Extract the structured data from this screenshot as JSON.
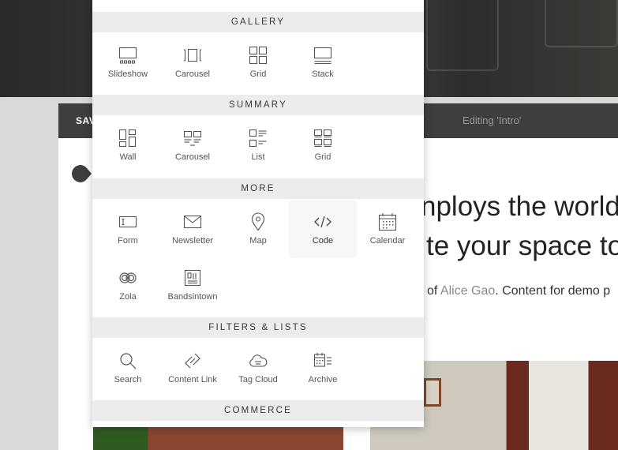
{
  "editor": {
    "save_label": "SAV",
    "editing_label": "Editing 'Intro'"
  },
  "page": {
    "headline_line1": "nploys the world",
    "headline_line2": "te your space to",
    "subline_prefix": "of ",
    "subline_link": "Alice Gao",
    "subline_suffix": ". Content for demo p"
  },
  "menu": {
    "sections": {
      "gallery": "GALLERY",
      "summary": "SUMMARY",
      "more": "MORE",
      "filters": "FILTERS & LISTS",
      "commerce": "COMMERCE"
    },
    "gallery": [
      {
        "label": "Slideshow",
        "icon": "slideshow-icon"
      },
      {
        "label": "Carousel",
        "icon": "carousel-icon"
      },
      {
        "label": "Grid",
        "icon": "grid-icon"
      },
      {
        "label": "Stack",
        "icon": "stack-icon"
      }
    ],
    "summary": [
      {
        "label": "Wall",
        "icon": "wall-icon"
      },
      {
        "label": "Carousel",
        "icon": "carousel-icon"
      },
      {
        "label": "List",
        "icon": "list-icon"
      },
      {
        "label": "Grid",
        "icon": "grid-icon"
      }
    ],
    "more": [
      {
        "label": "Form",
        "icon": "form-icon"
      },
      {
        "label": "Newsletter",
        "icon": "envelope-icon"
      },
      {
        "label": "Map",
        "icon": "map-pin-icon"
      },
      {
        "label": "Code",
        "icon": "code-icon"
      },
      {
        "label": "Calendar",
        "icon": "calendar-icon"
      },
      {
        "label": "Zola",
        "icon": "zola-rings-icon"
      },
      {
        "label": "Bandsintown",
        "icon": "bandsintown-icon"
      }
    ],
    "filters": [
      {
        "label": "Search",
        "icon": "search-icon"
      },
      {
        "label": "Content Link",
        "icon": "link-icon"
      },
      {
        "label": "Tag Cloud",
        "icon": "tag-cloud-icon"
      },
      {
        "label": "Archive",
        "icon": "archive-icon"
      }
    ]
  },
  "colors": {
    "editor_bar": "#3e3e3e",
    "section_header_bg": "#ececec",
    "label_text": "#555555"
  }
}
